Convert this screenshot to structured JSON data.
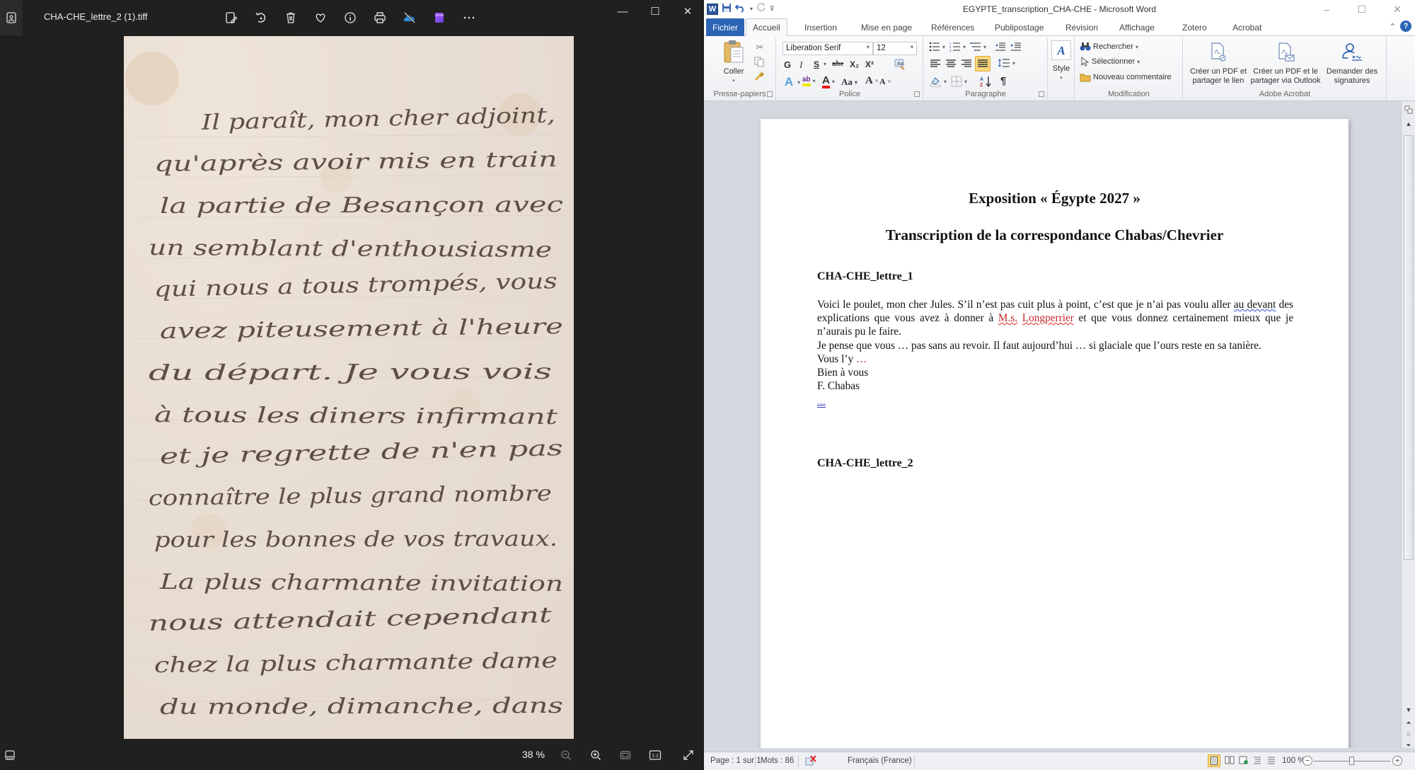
{
  "photos": {
    "file_name": "CHA-CHE_lettre_2 (1).tiff",
    "toolbar_icons": [
      "edit-image-icon",
      "rotate-icon",
      "delete-icon",
      "favorite-icon",
      "info-icon",
      "print-icon",
      "onedrive-icon",
      "clipchamp-icon",
      "more-icon"
    ],
    "window_controls": {
      "minimize": "—",
      "maximize": "☐",
      "close": "✕"
    },
    "zoom_level": "38 %",
    "letter_lines": [
      "Il paraît, mon cher adjoint,",
      "qu'après avoir mis en train",
      "la partie de Besançon avec",
      "un semblant d'enthousiasme",
      "qui nous a tous trompés, vous",
      "avez piteusement à l'heure",
      "du départ. Je vous vois",
      "à tous les diners infirmant",
      "et je regrette de n'en pas",
      "connaître le plus grand nombre",
      "pour les bonnes de vos travaux.",
      "La plus charmante invitation",
      "nous attendait cependant",
      "chez la plus charmante dame",
      "du monde, dimanche, dans"
    ]
  },
  "word": {
    "title": "EGYPTE_transcription_CHA-CHE - Microsoft Word",
    "tabs": [
      "Fichier",
      "Accueil",
      "Insertion",
      "Mise en page",
      "Références",
      "Publipostage",
      "Révision",
      "Affichage",
      "Zotero",
      "Acrobat"
    ],
    "active_tab": "Accueil",
    "ribbon": {
      "clipboard": {
        "paste_label": "Coller",
        "group_label": "Presse-papiers"
      },
      "font": {
        "font_name": "Liberation Serif",
        "font_size": "12",
        "bold": "G",
        "italic": "I",
        "underline": "S",
        "strike": "abe",
        "subscript": "X₂",
        "superscript": "X²",
        "change_case": "Aa",
        "grow": "A",
        "shrink": "A",
        "group_label": "Police"
      },
      "paragraph": {
        "group_label": "Paragraphe",
        "pilcrow": "¶"
      },
      "style": {
        "label": "Style"
      },
      "editing": {
        "find": "Rechercher",
        "select": "Sélectionner",
        "new_comment": "Nouveau commentaire",
        "group_label": "Modification"
      },
      "acrobat": {
        "btn1_line1": "Créer un PDF et",
        "btn1_line2": "partager le lien",
        "btn2_line1": "Créer un PDF et le",
        "btn2_line2": "partager via Outlook",
        "btn3_line1": "Demander des",
        "btn3_line2": "signatures",
        "group_label": "Adobe Acrobat"
      }
    },
    "document": {
      "title": "Exposition « Égypte 2027 »",
      "subtitle": "Transcription  de la correspondance  Chabas/Chevrier",
      "section1": "CHA-CHE_lettre_1",
      "p1_a": "Voici le poulet, mon cher Jules. S’il n’est pas cuit plus à point, c’est que je n’ai pas voulu aller ",
      "p1_squig1": "au devant",
      "p1_b": " des explications que vous avez à donner à ",
      "p1_red1": "M.s.",
      "p1_space": " ",
      "p1_red2": "Longperrier",
      "p1_c": " et que vous donnez certainement mieux que je n’aurais pu le faire.",
      "p2": "Je pense que vous … pas sans au revoir. Il faut aujourd’hui … si glaciale que l’ours reste en sa tanière.",
      "p3_a": "Vous l’y ",
      "p3_dots": "…",
      "p4": "Bien à vous",
      "p5": "F. Chabas",
      "p6_mark": "…",
      "section2": "CHA-CHE_lettre_2"
    },
    "status": {
      "page": "Page : 1 sur 1",
      "words": "Mots : 86",
      "language": "Français (France)",
      "zoom": "100 %",
      "zoom_fraction": 0.5
    }
  }
}
